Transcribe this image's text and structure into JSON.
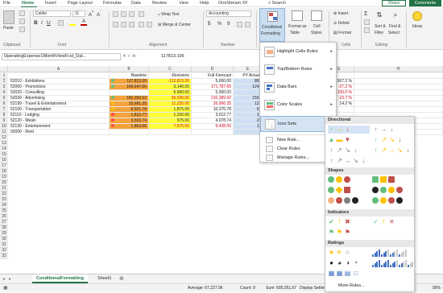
{
  "menu": {
    "tabs": [
      "File",
      "Home",
      "Insert",
      "Page Layout",
      "Formulas",
      "Data",
      "Review",
      "View",
      "Help",
      "OneStream XF"
    ],
    "active": "Home",
    "search_label": "Search",
    "share_label": "Share",
    "comments_label": "Comments"
  },
  "ribbon": {
    "paste_label": "Paste",
    "clipboard_label": "Clipboard",
    "font_name": "Calibri",
    "font_size": "11",
    "font_label": "Font",
    "wrap_text": "Wrap Text",
    "merge_center": "Merge & Center",
    "alignment_label": "Alignment",
    "number_format": "Accounting",
    "number_label": "Number",
    "cf_label_1": "Conditional",
    "cf_label_2": "Formatting",
    "format_as_1": "Format as",
    "format_as_2": "Table",
    "cell_styles_1": "Cell",
    "cell_styles_2": "Styles",
    "insert": "Insert",
    "delete": "Delete",
    "format": "Format",
    "cells_label": "Cells",
    "sort_1": "Sort &",
    "sort_2": "Filter",
    "find_1": "Find &",
    "find_2": "Select",
    "editing_label": "Editing",
    "ideas": "Ideas"
  },
  "formula_bar": {
    "name_box": "OperatingExpense1MonthViewFcst_Dat...",
    "fx": "fx",
    "value": "117813.196"
  },
  "columns": [
    "A",
    "B",
    "C",
    "D",
    "E",
    "F",
    "G",
    "H",
    "I"
  ],
  "headers_row": {
    "b": "Baseline",
    "c": "Revisions",
    "d": "Full Forecast",
    "e": "PY Actual"
  },
  "rows": [
    {
      "n": "1",
      "a": "",
      "b": "Baseline",
      "c": "Revisions",
      "d": "Full Forecast",
      "e": "PY Actual",
      "g": "",
      "h": ""
    },
    {
      "n": "2",
      "a": "52010 - Exhibitions",
      "b": "117,813.20",
      "c": "-112,813.20",
      "d": "5,000.00",
      "e": "88,",
      "g": "1567.2 %",
      "h": ""
    },
    {
      "n": "3",
      "a": "52000 - Promotions",
      "b": "166,647.65",
      "c": "5,140.00",
      "d": "171,787.65",
      "e": "124,",
      "g": "-27.2 %",
      "h": ""
    },
    {
      "n": "4",
      "a": "52020 - Consulting",
      "b": "",
      "c": "5,900.00",
      "d": "5,900.00",
      "e": "",
      "g": "-100.0 %",
      "h": ""
    },
    {
      "n": "5",
      "a": "52030 - Advertising",
      "b": "180,359.92",
      "c": "30,030.00",
      "d": "210,389.92",
      "e": "155,",
      "g": "-23.7 %",
      "h": ""
    },
    {
      "n": "6",
      "a": "52199 - Travel & Entertainment",
      "b": "15,681.35",
      "c": "11,225.00",
      "d": "26,906.35",
      "e": "12,",
      "g": "14.2 %",
      "h": ""
    },
    {
      "n": "7",
      "a": "  52100 - Transportation",
      "b": "8,501.78",
      "c": "1,875.00",
      "d": "10,376.78",
      "e": "6,",
      "g": "",
      "h": ""
    },
    {
      "n": "8",
      "a": "  52110 - Lodging",
      "b": "1,812.77",
      "c": "1,200.00",
      "d": "3,012.77",
      "e": "1,",
      "g": "",
      "h": ""
    },
    {
      "n": "9",
      "a": "  52120 - Meals",
      "b": "3,503.74",
      "c": "575.00",
      "d": "4,078.74",
      "e": "2,",
      "g": "",
      "h": ""
    },
    {
      "n": "10",
      "a": "  52130 - Entertainment",
      "b": "1,863.06",
      "c": "7,575.00",
      "d": "9,438.06",
      "e": "1,",
      "g": "",
      "h": ""
    },
    {
      "n": "11",
      "a": "92000 - Rent",
      "b": "",
      "c": "",
      "d": "",
      "e": "",
      "g": "",
      "h": ""
    }
  ],
  "more_rows": [
    "12",
    "13",
    "14",
    "15",
    "16",
    "17",
    "18",
    "19",
    "20",
    "21",
    "22",
    "23",
    "24",
    "25",
    "26",
    "27",
    "28",
    "29",
    "30",
    "31",
    "32",
    "33"
  ],
  "cf_menu": {
    "items": [
      "Highlight Cells Rules",
      "Top/Bottom Rules",
      "Data Bars",
      "Color Scales",
      "Icon Sets"
    ],
    "small_items": [
      "New Rule...",
      "Clear Rules",
      "Manage Rules..."
    ]
  },
  "icon_sets": {
    "directional": "Directional",
    "shapes": "Shapes",
    "indicators": "Indicators",
    "ratings": "Ratings",
    "more_rules": "More Rules..."
  },
  "sheet_tabs": [
    "ConditionalFormatting",
    "Sheet1"
  ],
  "status": {
    "average": "Average: 67,227.96",
    "count": "Count: 9",
    "sum": "Sum: 605,051.67",
    "display": "Display Settings",
    "zoom": "90%"
  },
  "colors": {
    "accent": "#217346",
    "orange": "#f4a23b",
    "yellow": "#ffff3a",
    "green": "#63be7b",
    "red": "#c0504d",
    "gray": "#7f7f7f"
  }
}
